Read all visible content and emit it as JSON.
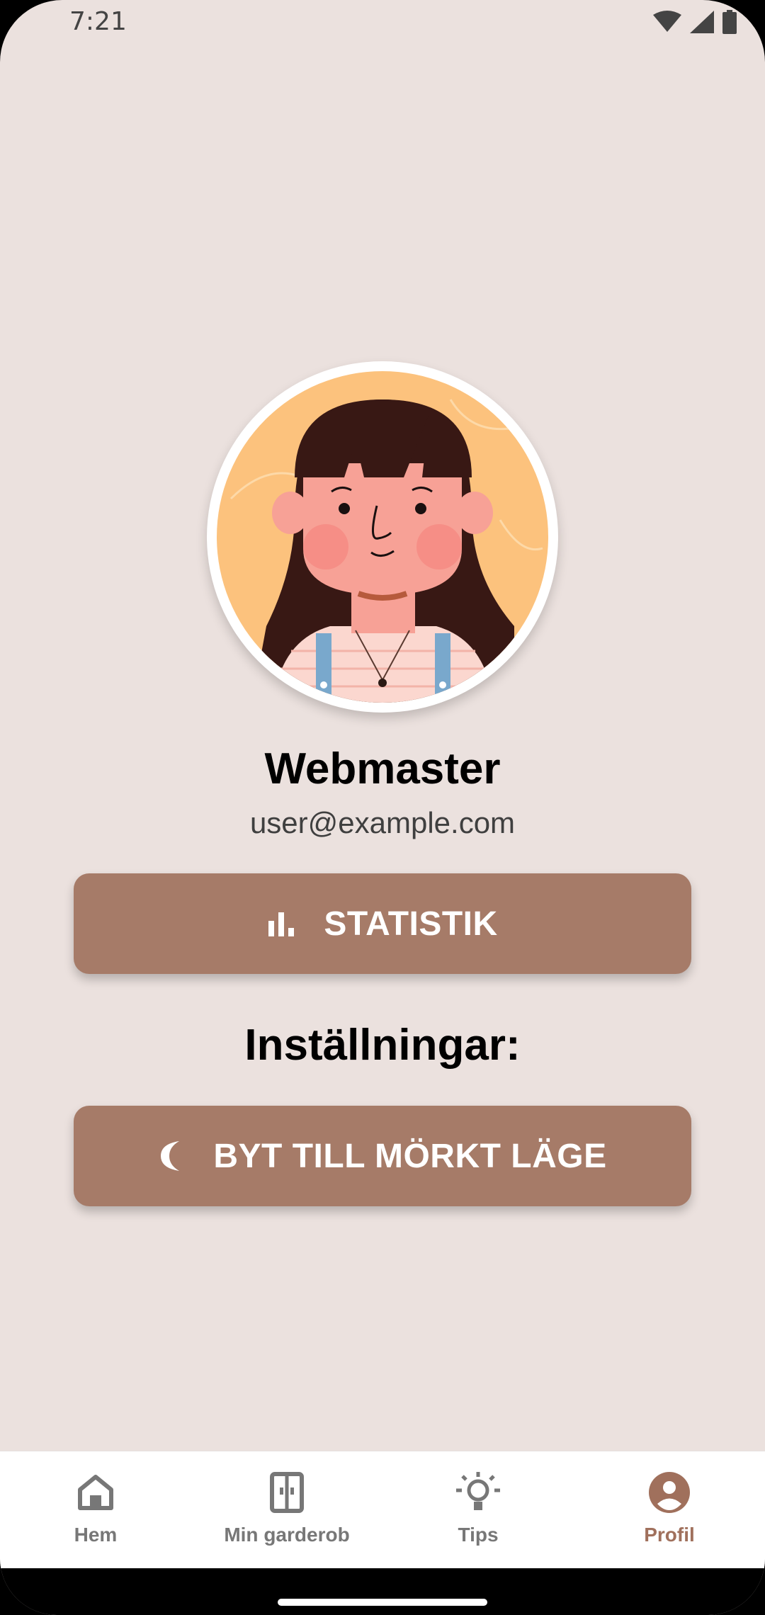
{
  "status_bar": {
    "time": "7:21",
    "icons": [
      "wifi-icon",
      "cell-signal-icon",
      "battery-icon"
    ]
  },
  "profile": {
    "avatar": "cartoon-girl-avatar",
    "name": "Webmaster",
    "email": "user@example.com"
  },
  "buttons": {
    "statistics_label": "STATISTIK",
    "statistics_icon": "bar-chart-icon",
    "settings_heading": "Inställningar:",
    "dark_mode_label": "BYT TILL MÖRKT LÄGE",
    "dark_mode_icon": "moon-icon"
  },
  "bottom_nav": {
    "items": [
      {
        "label": "Hem",
        "icon": "home-icon",
        "active": false
      },
      {
        "label": "Min garderob",
        "icon": "wardrobe-icon",
        "active": false
      },
      {
        "label": "Tips",
        "icon": "lightbulb-icon",
        "active": false
      },
      {
        "label": "Profil",
        "icon": "account-circle-icon",
        "active": true
      }
    ]
  },
  "colors": {
    "background": "#ebe1de",
    "button": "#a67b68",
    "active_nav": "#a0705c",
    "inactive_nav": "#777777"
  }
}
